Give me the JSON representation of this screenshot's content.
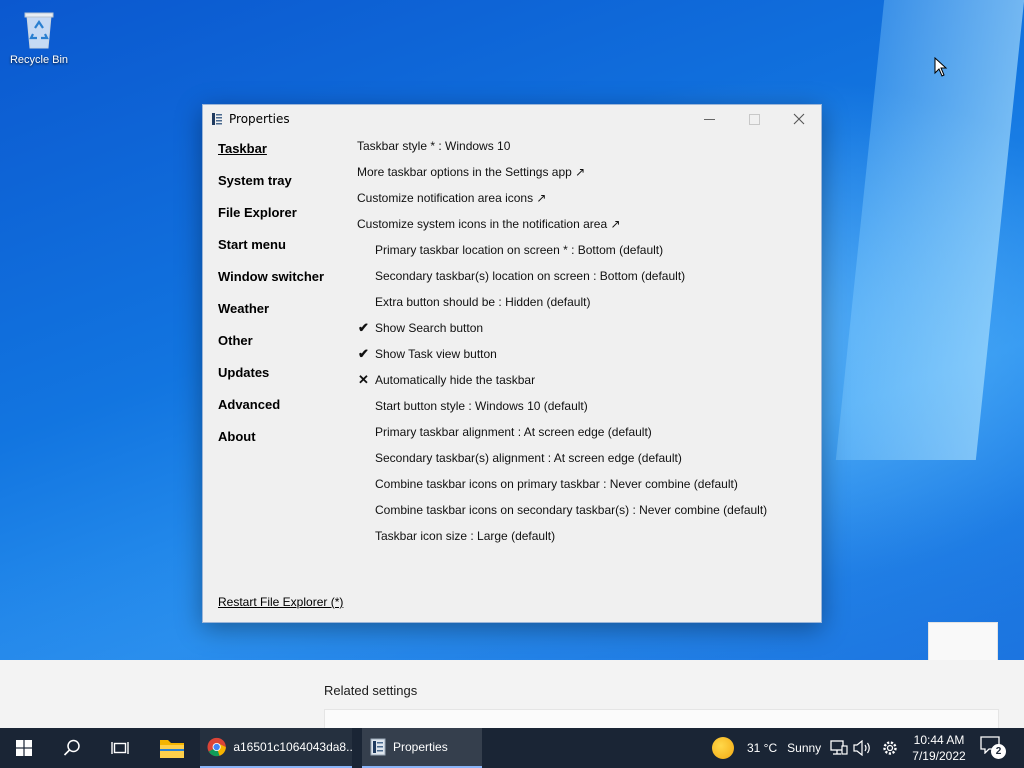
{
  "desktop": {
    "recycle_bin_label": "Recycle Bin"
  },
  "settings_background": {
    "related_settings": "Related settings"
  },
  "window": {
    "title": "Properties",
    "sidebar": [
      {
        "label": "Taskbar",
        "active": true
      },
      {
        "label": "System tray"
      },
      {
        "label": "File Explorer"
      },
      {
        "label": "Start menu"
      },
      {
        "label": "Window switcher"
      },
      {
        "label": "Weather"
      },
      {
        "label": "Other"
      },
      {
        "label": "Updates"
      },
      {
        "label": "Advanced"
      },
      {
        "label": "About"
      }
    ],
    "options": [
      {
        "text": "Taskbar style * : Windows 10",
        "indent": false,
        "mark": ""
      },
      {
        "text": "More taskbar options in the Settings app ↗",
        "indent": false,
        "mark": ""
      },
      {
        "text": "Customize notification area icons ↗",
        "indent": false,
        "mark": ""
      },
      {
        "text": "Customize system icons in the notification area ↗",
        "indent": false,
        "mark": ""
      },
      {
        "text": "Primary taskbar location on screen * : Bottom (default)",
        "indent": true,
        "mark": ""
      },
      {
        "text": "Secondary taskbar(s) location on screen : Bottom (default)",
        "indent": true,
        "mark": ""
      },
      {
        "text": "Extra button should be : Hidden (default)",
        "indent": true,
        "mark": ""
      },
      {
        "text": "Show Search button",
        "indent": true,
        "mark": "✔"
      },
      {
        "text": "Show Task view button",
        "indent": true,
        "mark": "✔"
      },
      {
        "text": "Automatically hide the taskbar",
        "indent": true,
        "mark": "✕"
      },
      {
        "text": "Start button style : Windows 10 (default)",
        "indent": true,
        "mark": ""
      },
      {
        "text": "Primary taskbar alignment : At screen edge (default)",
        "indent": true,
        "mark": ""
      },
      {
        "text": "Secondary taskbar(s) alignment : At screen edge (default)",
        "indent": true,
        "mark": ""
      },
      {
        "text": "Combine taskbar icons on primary taskbar : Never combine (default)",
        "indent": true,
        "mark": ""
      },
      {
        "text": "Combine taskbar icons on secondary taskbar(s) : Never combine (default)",
        "indent": true,
        "mark": ""
      },
      {
        "text": "Taskbar icon size : Large (default)",
        "indent": true,
        "mark": ""
      }
    ],
    "restart_link": "Restart File Explorer (*)"
  },
  "taskbar": {
    "chrome_label": "a16501c1064043da8...",
    "properties_label": "Properties",
    "weather_temp": "31 °C",
    "weather_cond": "Sunny",
    "time": "10:44 AM",
    "date": "7/19/2022",
    "notification_count": "2"
  },
  "colors": {
    "taskbar_bg": "#1a2535",
    "window_bg": "#f0f0f0",
    "accent": "#8ab4f8"
  }
}
